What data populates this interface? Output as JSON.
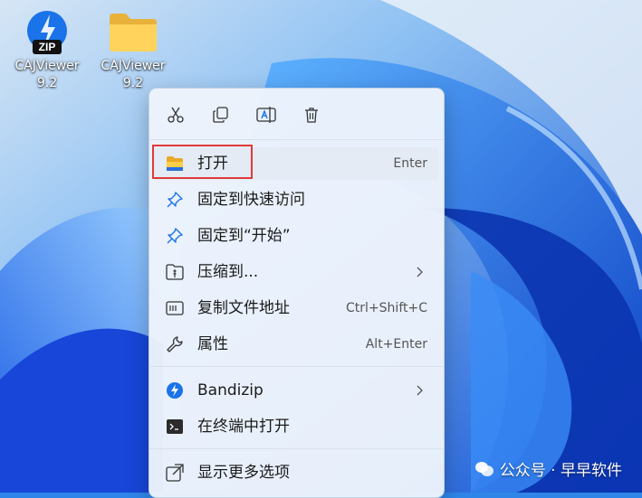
{
  "desktop": {
    "icons": [
      {
        "label": "CAJViewer\n9.2",
        "icon": "zip-archive-icon",
        "badge": "ZIP"
      },
      {
        "label": "CAJViewer\n9.2",
        "icon": "folder-icon"
      }
    ]
  },
  "context_menu": {
    "toolbar": [
      {
        "name": "cut",
        "icon": "scissors-icon"
      },
      {
        "name": "copy",
        "icon": "copy-icon"
      },
      {
        "name": "rename",
        "icon": "rename-icon"
      },
      {
        "name": "delete",
        "icon": "trash-icon"
      }
    ],
    "items": [
      {
        "label": "打开",
        "shortcut": "Enter",
        "icon": "folder-open-icon"
      },
      {
        "label": "固定到快速访问",
        "icon": "pin-icon"
      },
      {
        "label": "固定到“开始”",
        "icon": "pin-icon"
      },
      {
        "label": "压缩到...",
        "icon": "compress-icon",
        "submenu": true
      },
      {
        "label": "复制文件地址",
        "shortcut": "Ctrl+Shift+C",
        "icon": "copy-path-icon"
      },
      {
        "label": "属性",
        "shortcut": "Alt+Enter",
        "icon": "wrench-icon"
      },
      {
        "label": "Bandizip",
        "icon": "bandizip-icon",
        "submenu": true
      },
      {
        "label": "在终端中打开",
        "icon": "terminal-icon"
      },
      {
        "label": "显示更多选项",
        "icon": "more-options-icon"
      }
    ]
  },
  "watermark": {
    "text": "公众号 · 早早软件"
  },
  "colors": {
    "highlight_border": "#e03a3a",
    "accent": "#1a73e8"
  }
}
